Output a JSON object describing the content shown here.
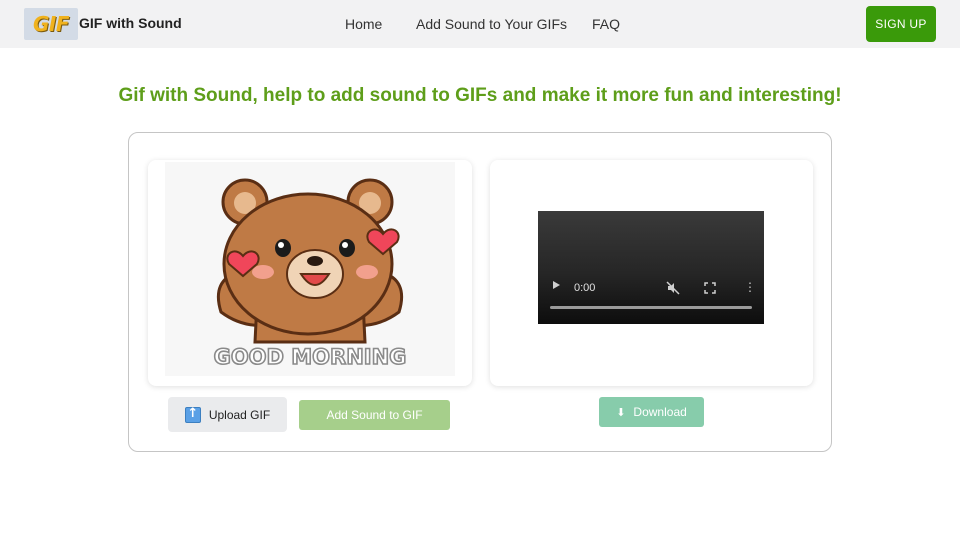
{
  "header": {
    "logo_text": "GIF",
    "brand": "GIF with Sound",
    "nav": [
      "Home",
      "Add Sound to Your GIFs",
      "FAQ"
    ],
    "signup_label": "SIGN UP",
    "brand_color": "#3a9a0a"
  },
  "main": {
    "headline": "Gif with Sound, help to add sound to GIFs and make it more fun and interesting!",
    "headline_color": "#5e9e1a",
    "gif_caption": "GOOD MORNING",
    "video": {
      "time": "0:00",
      "icons": [
        "play-icon",
        "mute-icon",
        "fullscreen-icon",
        "more-icon"
      ]
    },
    "upload_label": "Upload GIF",
    "upload_icon": "upload-icon",
    "add_sound_label": "Add Sound to GIF",
    "download_label": "Download",
    "download_icon": "download-icon"
  }
}
